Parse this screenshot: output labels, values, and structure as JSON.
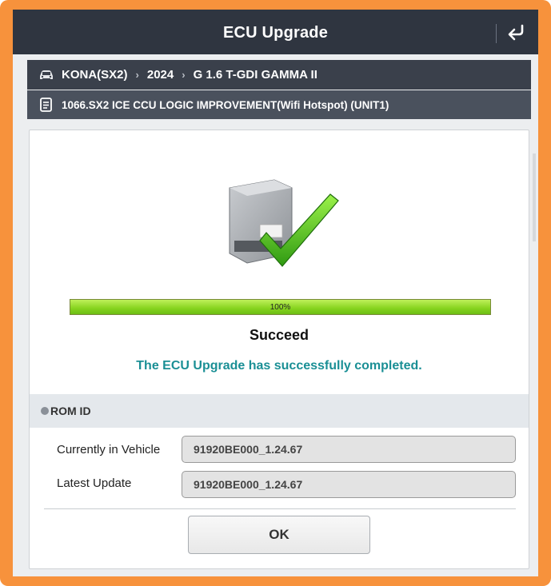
{
  "window": {
    "title": "ECU Upgrade",
    "back_icon": "return-arrow-icon"
  },
  "breadcrumb": {
    "car_icon": "car-icon",
    "model": "KONA(SX2)",
    "year": "2024",
    "engine": "G 1.6 T-GDI GAMMA II",
    "separator": "›"
  },
  "task": {
    "doc_icon": "document-icon",
    "label": "1066.SX2 ICE CCU LOGIC IMPROVEMENT(Wifi Hotspot) (UNIT1)"
  },
  "status": {
    "image_icon": "ecu-check-icon",
    "progress_value": 100,
    "progress_label": "100%",
    "result": "Succeed",
    "message": "The ECU Upgrade has successfully completed.",
    "message_color": "#1a8f95",
    "progress_color": "#86d31e"
  },
  "rom": {
    "section_title": "ROM ID",
    "rows": [
      {
        "label": "Currently in Vehicle",
        "value": "91920BE000_1.24.67"
      },
      {
        "label": "Latest Update",
        "value": "91920BE000_1.24.67"
      }
    ]
  },
  "actions": {
    "ok_label": "OK"
  },
  "colors": {
    "frame": "#f7923c",
    "titlebar": "#2f3540",
    "crumbs": "#3a404b",
    "subrow": "#4a515d"
  }
}
